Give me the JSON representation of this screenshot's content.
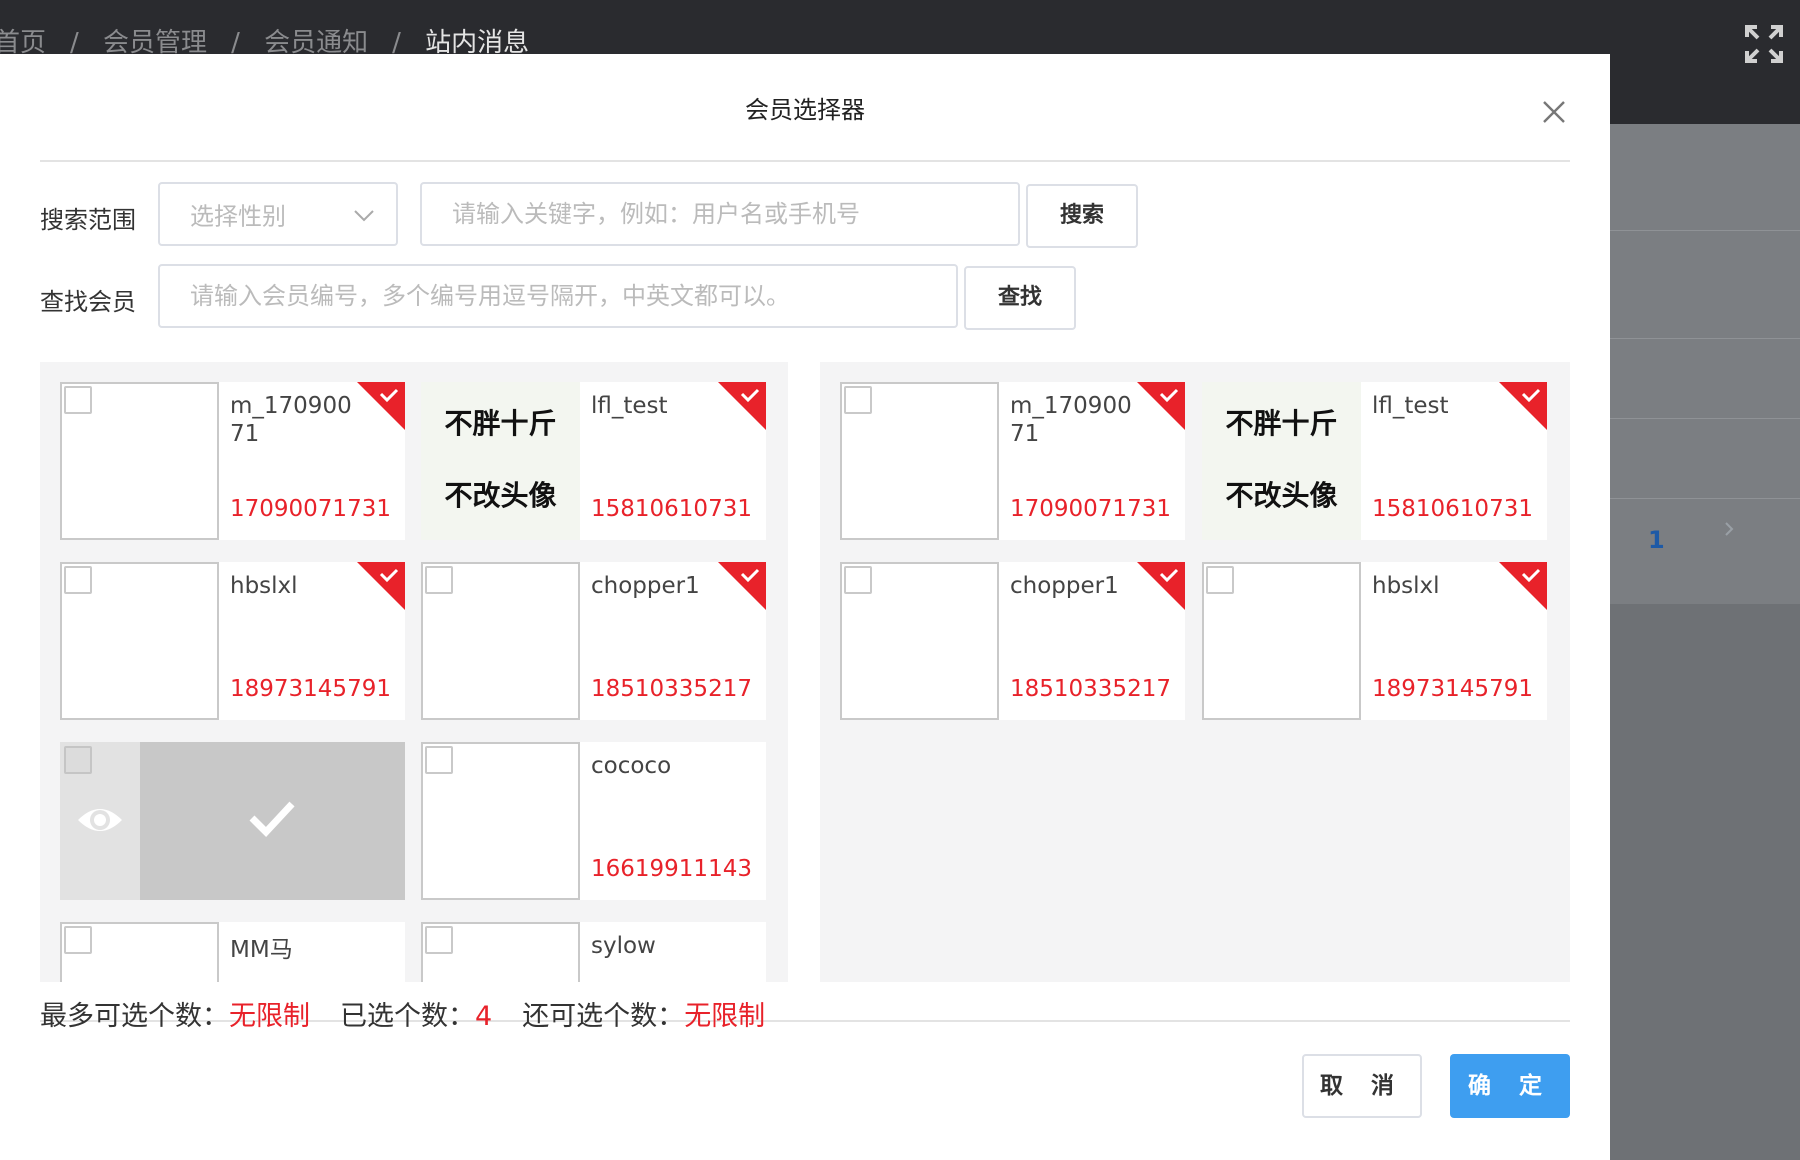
{
  "background": {
    "breadcrumb": [
      "首页",
      "会员管理",
      "会员通知",
      "站内消息"
    ],
    "page_number": "1"
  },
  "modal": {
    "title": "会员选择器",
    "search": {
      "range_label": "搜索范围",
      "gender_placeholder": "选择性别",
      "keyword_placeholder": "请输入关键字，例如：用户名或手机号",
      "search_button": "搜索",
      "find_label": "查找会员",
      "member_ids_placeholder": "请输入会员编号，多个编号用逗号隔开，中英文都可以。",
      "find_button": "查找"
    },
    "available_members": [
      {
        "username": "m_17090071",
        "phone": "17090071731",
        "avatar_text": "",
        "selected": true
      },
      {
        "username": "lfl_test",
        "phone": "15810610731",
        "avatar_text": [
          "不胖十斤",
          "不改头像"
        ],
        "selected": true
      },
      {
        "username": "hbslxl",
        "phone": "18973145791",
        "avatar_text": "",
        "selected": true
      },
      {
        "username": "chopper1",
        "phone": "18510335217",
        "avatar_text": "",
        "selected": true
      },
      {
        "username": "",
        "phone": "",
        "avatar_text": "",
        "selected": false,
        "hovered": true
      },
      {
        "username": "cococo",
        "phone": "16619911143",
        "avatar_text": "",
        "selected": false
      },
      {
        "username": "MM马",
        "phone": "",
        "avatar_text": "",
        "selected": false
      },
      {
        "username": "sylow",
        "phone": "",
        "avatar_text": "",
        "selected": false
      }
    ],
    "selected_members": [
      {
        "username": "m_17090071",
        "phone": "17090071731",
        "avatar_text": "",
        "selected": true
      },
      {
        "username": "lfl_test",
        "phone": "15810610731",
        "avatar_text": [
          "不胖十斤",
          "不改头像"
        ],
        "selected": true
      },
      {
        "username": "chopper1",
        "phone": "18510335217",
        "avatar_text": "",
        "selected": true
      },
      {
        "username": "hbslxl",
        "phone": "18973145791",
        "avatar_text": "",
        "selected": true
      }
    ],
    "footer": {
      "max_label": "最多可选个数：",
      "max_value": "无限制",
      "selected_label": "已选个数：",
      "selected_value": "4",
      "remaining_label": "还可选个数：",
      "remaining_value": "无限制",
      "cancel_button": "取 消",
      "ok_button": "确 定"
    },
    "colors": {
      "accent": "#3e9ef0",
      "highlight": "#e8222a"
    }
  }
}
